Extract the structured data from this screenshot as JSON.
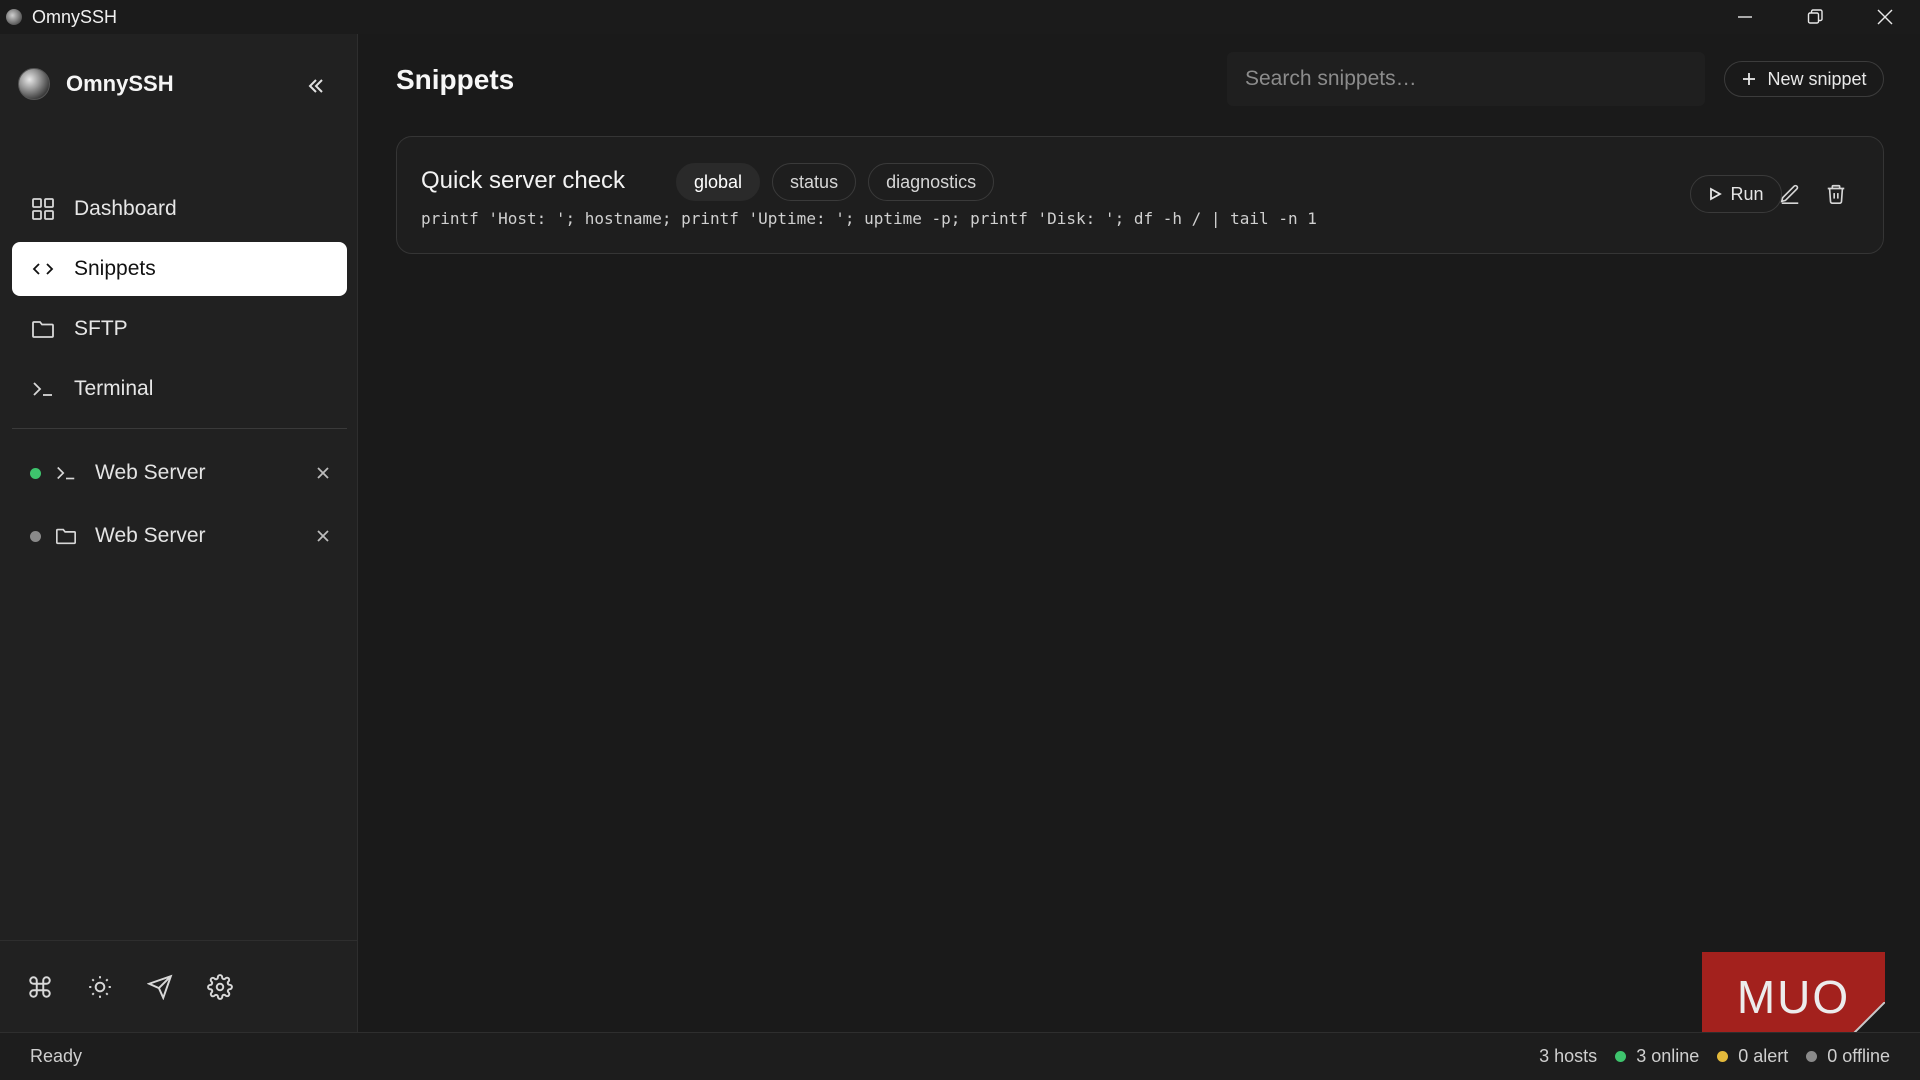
{
  "window": {
    "title": "OmnySSH"
  },
  "sidebar": {
    "brand": "OmnySSH",
    "nav": [
      {
        "label": "Dashboard",
        "icon": "grid-icon",
        "active": false
      },
      {
        "label": "Snippets",
        "icon": "code-icon",
        "active": true
      },
      {
        "label": "SFTP",
        "icon": "folder-icon",
        "active": false
      },
      {
        "label": "Terminal",
        "icon": "terminal-icon",
        "active": false
      }
    ],
    "sessions": [
      {
        "label": "Web Server",
        "type": "terminal",
        "status_color": "#3ec46d"
      },
      {
        "label": "Web Server",
        "type": "sftp",
        "status_color": "#8a8a8a"
      }
    ],
    "tools": [
      "command-icon",
      "sun-icon",
      "send-icon",
      "gear-icon"
    ]
  },
  "main": {
    "title": "Snippets",
    "search_placeholder": "Search snippets…",
    "new_button": "New snippet",
    "snippets": [
      {
        "title": "Quick server check",
        "tags": [
          "global",
          "status",
          "diagnostics"
        ],
        "command": "printf 'Host: '; hostname; printf 'Uptime: '; uptime -p; printf 'Disk: '; df -h / | tail -n 1",
        "run_label": "Run"
      }
    ]
  },
  "watermark": "MUO",
  "statusbar": {
    "left": "Ready",
    "hosts": "3 hosts",
    "online": "3 online",
    "alert": "0 alert",
    "offline": "0 offline",
    "colors": {
      "online": "#3ec46d",
      "alert": "#e3b93b",
      "offline": "#8a8a8a"
    }
  }
}
